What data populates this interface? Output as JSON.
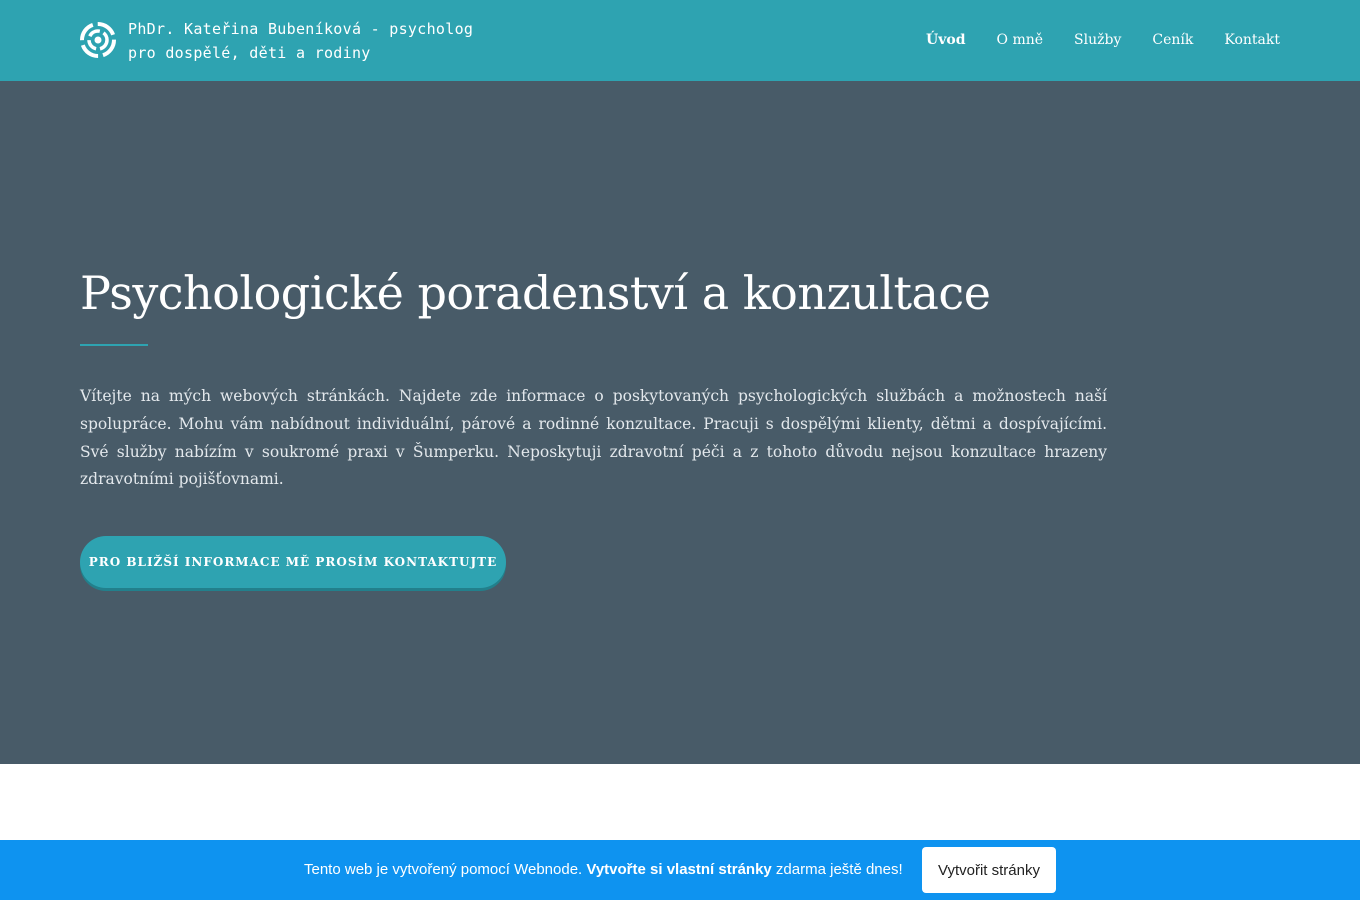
{
  "header": {
    "brand_line1": "PhDr. Kateřina Bubeníková - psycholog",
    "brand_line2": "pro dospělé, děti a rodiny",
    "logo_icon": "swirl-logo-icon",
    "nav": [
      {
        "label": "Úvod",
        "active": true
      },
      {
        "label": "O mně",
        "active": false
      },
      {
        "label": "Služby",
        "active": false
      },
      {
        "label": "Ceník",
        "active": false
      },
      {
        "label": "Kontakt",
        "active": false
      }
    ]
  },
  "hero": {
    "title": "Psychologické poradenství a konzultace",
    "text": "Vítejte na mých webových stránkách. Najdete zde informace o poskytovaných psychologických službách a možnostech naší spolupráce. Mohu vám nabídnout individuální, párové a rodinné konzultace. Pracuji s dospělými klienty, dětmi a dospívajícími. Své služby nabízím v soukromé praxi v Šumperku. Neposkytuji zdravotní péči a z tohoto důvodu nejsou konzultace hrazeny zdravotními pojišťovnami.",
    "button_label": "PRO BLIŽŠÍ INFORMACE MĚ PROSÍM KONTAKTUJTE"
  },
  "banner": {
    "text_start": "Tento web je vytvořený pomocí Webnode. ",
    "text_bold": "Vytvořte si vlastní stránky",
    "text_end": " zdarma ještě dnes!",
    "button_label": "Vytvořit stránky"
  },
  "colors": {
    "header_bg": "#2ea3b1",
    "hero_bg": "#485b68",
    "accent": "#2ea3b1",
    "banner_bg": "#0e93f0"
  }
}
